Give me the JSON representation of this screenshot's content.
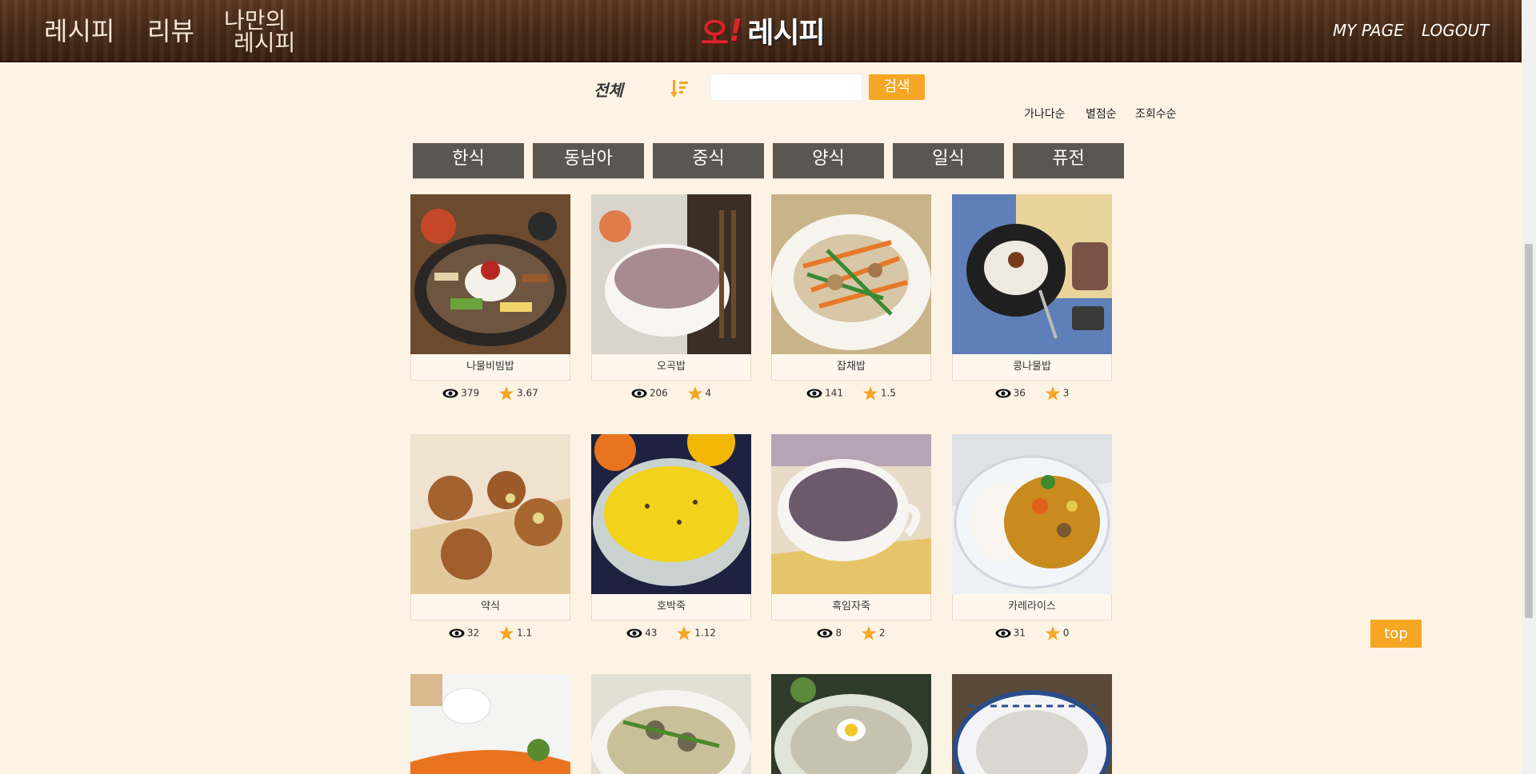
{
  "header": {
    "nav": {
      "recipe": "레시피",
      "review": "리뷰",
      "my_recipe_line1": "나만의",
      "my_recipe_line2": "레시피"
    },
    "logo": {
      "o": "오",
      "exclaim": "!",
      "word": "레시피"
    },
    "mypage": "MY PAGE",
    "logout": "LOGOUT"
  },
  "search": {
    "category": "전체",
    "input_value": "",
    "button": "검색",
    "sort_options": [
      "가나다순",
      "별점순",
      "조회수순"
    ]
  },
  "tabs": [
    "한식",
    "동남아",
    "중식",
    "양식",
    "일식",
    "퓨전"
  ],
  "recipes": [
    {
      "name": "나물비빔밥",
      "views": "379",
      "rating": "3.67"
    },
    {
      "name": "오곡밥",
      "views": "206",
      "rating": "4"
    },
    {
      "name": "잡채밥",
      "views": "141",
      "rating": "1.5"
    },
    {
      "name": "콩나물밥",
      "views": "36",
      "rating": "3"
    },
    {
      "name": "약식",
      "views": "32",
      "rating": "1.1"
    },
    {
      "name": "호박죽",
      "views": "43",
      "rating": "1.12"
    },
    {
      "name": "흑임자죽",
      "views": "8",
      "rating": "2"
    },
    {
      "name": "카레라이스",
      "views": "31",
      "rating": "0"
    }
  ],
  "top_button": "top",
  "colors": {
    "accent": "#f5a623",
    "tab_bg": "#5c5650",
    "page_bg": "#fdf3e5",
    "logo_red": "#d8252a"
  }
}
